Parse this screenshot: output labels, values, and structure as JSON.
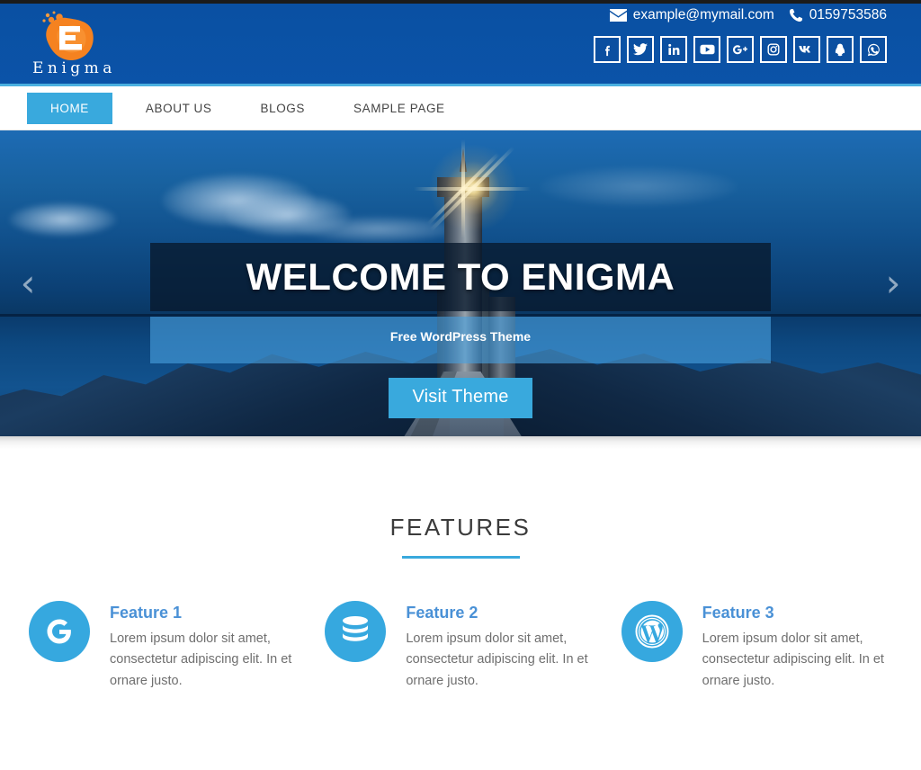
{
  "header": {
    "logo_text": "Enigma",
    "contact": {
      "email_icon": "envelope-icon",
      "email": "example@mymail.com",
      "phone_icon": "phone-icon",
      "phone": "0159753586"
    },
    "social": [
      {
        "name": "facebook-icon",
        "label": "Facebook"
      },
      {
        "name": "twitter-icon",
        "label": "Twitter"
      },
      {
        "name": "linkedin-icon",
        "label": "LinkedIn"
      },
      {
        "name": "youtube-icon",
        "label": "YouTube"
      },
      {
        "name": "google-plus-icon",
        "label": "Google Plus"
      },
      {
        "name": "instagram-icon",
        "label": "Instagram"
      },
      {
        "name": "vk-icon",
        "label": "VK"
      },
      {
        "name": "qq-icon",
        "label": "QQ"
      },
      {
        "name": "whatsapp-icon",
        "label": "WhatsApp"
      }
    ]
  },
  "nav": {
    "items": [
      {
        "label": "HOME",
        "active": true
      },
      {
        "label": "ABOUT US",
        "active": false
      },
      {
        "label": "BLOGS",
        "active": false
      },
      {
        "label": "SAMPLE PAGE",
        "active": false
      }
    ]
  },
  "hero": {
    "title": "WELCOME TO ENIGMA",
    "subtitle": "Free WordPress Theme",
    "button_label": "Visit Theme",
    "prev_arrow": "‹",
    "next_arrow": "›"
  },
  "features": {
    "title": "FEATURES",
    "items": [
      {
        "icon": "google-g-icon",
        "name": "Feature 1",
        "description": "Lorem ipsum dolor sit amet, consectetur adipiscing elit. In et ornare justo."
      },
      {
        "icon": "database-icon",
        "name": "Feature 2",
        "description": "Lorem ipsum dolor sit amet, consectetur adipiscing elit. In et ornare justo."
      },
      {
        "icon": "wordpress-icon",
        "name": "Feature 3",
        "description": "Lorem ipsum dolor sit amet, consectetur adipiscing elit. In et ornare justo."
      }
    ]
  },
  "colors": {
    "header_blue": "#0b52a4",
    "accent_blue": "#39a9dd",
    "logo_orange": "#f07d1a",
    "feature_heading": "#4a91d6",
    "body_text": "#6f6f6f"
  }
}
